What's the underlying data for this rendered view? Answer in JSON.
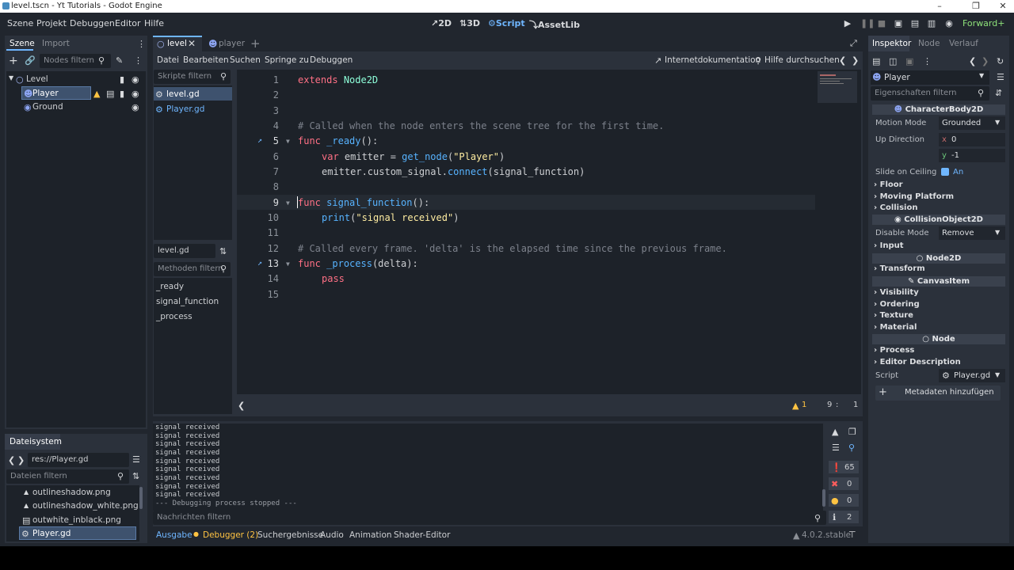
{
  "window": {
    "title": "level.tscn - Yt Tutorials - Godot Engine"
  },
  "menubar": {
    "items": [
      "Szene",
      "Projekt",
      "Debuggen",
      "Editor",
      "Hilfe"
    ],
    "workspaces": [
      "2D",
      "3D",
      "Script",
      "AssetLib"
    ],
    "renderer": "Forward+"
  },
  "scene_dock": {
    "tabs": [
      "Szene",
      "Import"
    ],
    "filter_placeholder": "Nodes filtern",
    "nodes": [
      "Level",
      "Player",
      "Ground"
    ]
  },
  "filesystem_dock": {
    "title": "Dateisystem",
    "path": "res://Player.gd",
    "filter_placeholder": "Dateien filtern",
    "files": [
      "outlineshadow.png",
      "outlineshadow_white.png",
      "outwhite_inblack.png",
      "Player.gd"
    ]
  },
  "editor_tabs": [
    "level",
    "player"
  ],
  "script_menu": {
    "items": [
      "Datei",
      "Bearbeiten",
      "Suchen",
      "Springe zu",
      "Debuggen"
    ],
    "online_docs": "Internetdokumentation",
    "search_help": "Hilfe durchsuchen"
  },
  "script_list": {
    "filter_placeholder": "Skripte filtern",
    "scripts": [
      "level.gd",
      "Player.gd"
    ],
    "current": "level.gd",
    "methods_filter_placeholder": "Methoden filtern",
    "methods": [
      "_ready",
      "signal_function",
      "_process"
    ]
  },
  "code": {
    "line_numbers": [
      "1",
      "2",
      "3",
      "4",
      "5",
      "6",
      "7",
      "8",
      "9",
      "10",
      "11",
      "12",
      "13",
      "14",
      "15"
    ],
    "l1": {
      "kw": "extends",
      "ty": "Node2D"
    },
    "l4": "# Called when the node enters the scene tree for the first time.",
    "l5": {
      "kw": "func",
      "fn": "_ready",
      "rest": "():"
    },
    "l6": {
      "kw": "var",
      "a": " emitter = ",
      "fn": "get_node",
      "b": "(",
      "st": "\"Player\"",
      "c": ")"
    },
    "l7": {
      "a": "emitter.custom_signal.",
      "fn": "connect",
      "b": "(signal_function)"
    },
    "l9": {
      "kw": "func",
      "fn": "signal_function",
      "rest": "():"
    },
    "l10": {
      "fn": "print",
      "a": "(",
      "st": "\"signal received\"",
      "b": ")"
    },
    "l12": "# Called every frame. 'delta' is the elapsed time since the previous frame.",
    "l13": {
      "kw": "func",
      "fn": "_process",
      "rest": "(delta):"
    },
    "l14": {
      "kw": "pass"
    }
  },
  "status": {
    "warnings": "1",
    "line": "9",
    "col": "1"
  },
  "output": {
    "lines": [
      "signal received",
      "signal received",
      "signal received",
      "signal received",
      "signal received",
      "signal received",
      "signal received",
      "signal received",
      "signal received"
    ],
    "stopped": "--- Debugging process stopped ---",
    "filter_placeholder": "Nachrichten filtern",
    "counts": {
      "messages": "65",
      "errors": "0",
      "warnings": "0",
      "info": "2"
    }
  },
  "bottom_tabs": [
    "Ausgabe",
    "Debugger (2)",
    "Suchergebnisse",
    "Audio",
    "Animation",
    "Shader-Editor"
  ],
  "version": "4.0.2.stable",
  "inspector": {
    "tabs": [
      "Inspektor",
      "Node",
      "Verlauf"
    ],
    "object": "Player",
    "filter_placeholder": "Eigenschaften filtern",
    "class1": "CharacterBody2D",
    "motion_mode_label": "Motion Mode",
    "motion_mode_value": "Grounded",
    "up_dir_label": "Up Direction",
    "x_label": "x",
    "x_value": "0",
    "y_label": "y",
    "y_value": "-1",
    "slide_label": "Slide on Ceiling",
    "slide_value": "An",
    "sections1": [
      "Floor",
      "Moving Platform",
      "Collision"
    ],
    "class2": "CollisionObject2D",
    "disable_mode_label": "Disable Mode",
    "disable_mode_value": "Remove",
    "sections2": [
      "Input"
    ],
    "class3": "Node2D",
    "sections3": [
      "Transform"
    ],
    "class4": "CanvasItem",
    "sections4": [
      "Visibility",
      "Ordering",
      "Texture",
      "Material"
    ],
    "class5": "Node",
    "sections5": [
      "Process",
      "Editor Description"
    ],
    "script_label": "Script",
    "script_value": "Player.gd",
    "add_metadata": "Metadaten hinzufügen"
  },
  "colors": {
    "accent": "#6fb6ff",
    "keyword": "#ff7085",
    "function": "#57b3ff",
    "string": "#ffeda1",
    "comment": "#7c818b",
    "type": "#8effda",
    "warning": "#ffc342"
  }
}
